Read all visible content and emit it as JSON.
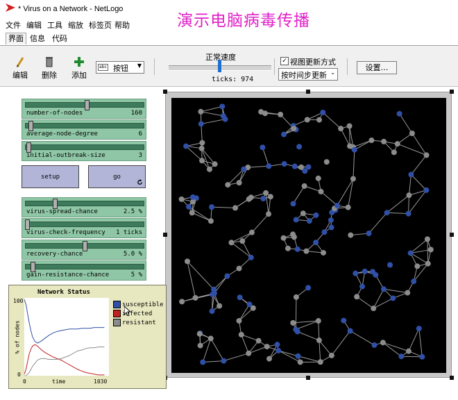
{
  "window": {
    "title": "* Virus on a Network - NetLogo"
  },
  "overlay_caption": "演示电脑病毒传播",
  "menu": [
    "文件",
    "编辑",
    "工具",
    "缩放",
    "标签页",
    "帮助"
  ],
  "tabs": [
    "界面",
    "信息",
    "代码"
  ],
  "toolbar": {
    "edit_label": "编辑",
    "delete_label": "删除",
    "add_label": "添加",
    "widget_type": "按钮",
    "widget_type_prefix": "abc",
    "speed_label": "正常速度",
    "ticks_text": "ticks: 974",
    "view_update_label": "视图更新方式",
    "update_mode": "按时间步更新",
    "settings_label": "设置…"
  },
  "sliders": [
    {
      "name": "number-of-nodes",
      "value_text": "160",
      "fraction": 0.52
    },
    {
      "name": "average-node-degree",
      "value_text": "6",
      "fraction": 0.03
    },
    {
      "name": "initial-outbreak-size",
      "value_text": "3",
      "fraction": 0.01
    },
    {
      "name": "virus-spread-chance",
      "value_text": "2.5 %",
      "fraction": 0.24
    },
    {
      "name": "virus-check-frequency",
      "value_text": "1 ticks",
      "fraction": 0.0
    },
    {
      "name": "recovery-chance",
      "value_text": "5.0 %",
      "fraction": 0.5
    },
    {
      "name": "gain-resistance-chance",
      "value_text": "5 %",
      "fraction": 0.05
    }
  ],
  "buttons": {
    "setup": "setup",
    "go": "go"
  },
  "colors": {
    "susceptible": "#3050a8",
    "infected": "#c02020",
    "resistant": "#8c8c8c",
    "slider_bg": "#8fc7a6",
    "button_bg": "#b3b5d8",
    "plot_bg": "#e8e8c0"
  },
  "plot": {
    "title": "Network Status",
    "xlabel": "time",
    "ylabel": "% of nodes",
    "x_min": "0",
    "x_max": "1030",
    "y_max": "100",
    "y_min": "0",
    "legend": [
      "susceptible",
      "infected",
      "resistant"
    ]
  },
  "chart_data": {
    "type": "line",
    "title": "Network Status",
    "xlabel": "time",
    "ylabel": "% of nodes",
    "xlim": [
      0,
      1030
    ],
    "ylim": [
      0,
      100
    ],
    "x": [
      0,
      20,
      40,
      60,
      80,
      100,
      130,
      160,
      200,
      250,
      300,
      350,
      400,
      450,
      500,
      550,
      600,
      650,
      700,
      750,
      800,
      850,
      900,
      974
    ],
    "series": [
      {
        "name": "susceptible",
        "values": [
          98,
          92,
          80,
          68,
          58,
          50,
          44,
          42,
          44,
          48,
          52,
          55,
          57,
          58,
          59,
          60,
          60,
          60,
          61,
          61,
          61,
          62,
          62,
          62
        ]
      },
      {
        "name": "infected",
        "values": [
          2,
          8,
          18,
          28,
          34,
          38,
          40,
          38,
          34,
          30,
          27,
          24,
          22,
          20,
          17,
          14,
          11,
          8,
          6,
          4,
          3,
          2,
          1,
          1
        ]
      },
      {
        "name": "resistant",
        "values": [
          0,
          0,
          2,
          4,
          8,
          12,
          16,
          20,
          22,
          22,
          21,
          21,
          21,
          22,
          24,
          26,
          29,
          32,
          33,
          35,
          36,
          36,
          37,
          37
        ]
      }
    ]
  }
}
